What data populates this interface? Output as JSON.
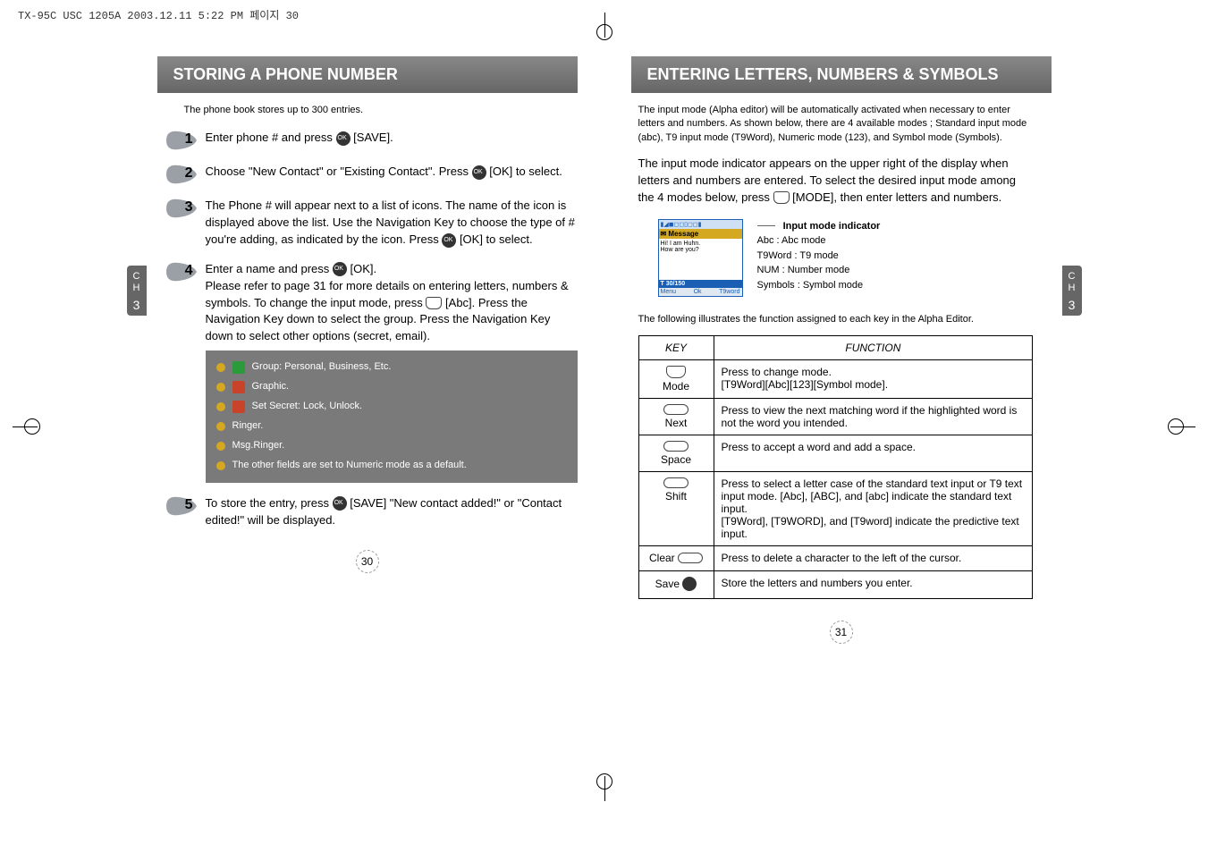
{
  "meta": {
    "header": "TX-95C USC 1205A  2003.12.11 5:22 PM  페이지 30"
  },
  "chapter_tab": {
    "label": "C\nH",
    "num": "3"
  },
  "left": {
    "title": "STORING A PHONE NUMBER",
    "intro": "The phone book stores up to 300 entries.",
    "steps": [
      {
        "n": "1",
        "text_a": "Enter phone # and press ",
        "text_b": " [SAVE]."
      },
      {
        "n": "2",
        "text_a": "Choose \"New Contact\" or \"Existing Contact\". Press ",
        "text_b": " [OK] to select."
      },
      {
        "n": "3",
        "text_a": "The Phone # will appear next to a list of icons. The name of the icon is displayed above the list. Use the Navigation Key to choose the type of # you're adding, as indicated by the icon. Press ",
        "text_b": " [OK] to select."
      },
      {
        "n": "4",
        "text_a": "Enter a name and press ",
        "text_b": " [OK].\nPlease refer to page 31 for more details on entering letters, numbers & symbols. To change the input mode, press ",
        "text_c": " [Abc]. Press the Navigation Key down to select the group. Press the Navigation Key down to select other options (secret, email)."
      },
      {
        "n": "5",
        "text_a": "To store the entry, press ",
        "text_b": " [SAVE] \"New contact added!\" or \"Contact edited!\" will be displayed."
      }
    ],
    "bullets": [
      "Group: Personal, Business, Etc.",
      "Graphic.",
      "Set Secret: Lock, Unlock.",
      "Ringer.",
      "Msg.Ringer.",
      "The other fields are set to Numeric mode as a default."
    ],
    "page_num": "30"
  },
  "right": {
    "title": "ENTERING LETTERS, NUMBERS & SYMBOLS",
    "intro": "The input mode (Alpha editor) will be automatically activated when necessary to enter letters and numbers. As shown below, there are 4 available modes ; Standard input mode (abc), T9 input mode (T9Word), Numeric mode (123), and Symbol mode (Symbols).",
    "intro2_a": "The input mode indicator appears on the upper right of the display when letters and numbers are entered. To select the desired input mode among the 4 modes below, press ",
    "intro2_b": " [MODE], then enter letters and numbers.",
    "phone": {
      "statusbar": "▮◢◼◻◻▯◻◻▮",
      "titlebar": "✉ Message",
      "body_line1": "Hi! I am Huhn.",
      "body_line2": "How are you?",
      "footer": "T 30/150",
      "soft_left": "Menu",
      "soft_mid": "Ok",
      "soft_right": "T9word"
    },
    "indicator": {
      "heading": "Input mode indicator",
      "l1": "Abc : Abc mode",
      "l2": "T9Word : T9 mode",
      "l3": "NUM : Number mode",
      "l4": "Symbols : Symbol mode"
    },
    "table_intro": "The following illustrates the function assigned to each key in the Alpha Editor.",
    "table": {
      "head_key": "KEY",
      "head_func": "FUNCTION",
      "rows": [
        {
          "key": "Mode",
          "func": "Press to change mode.\n[T9Word][Abc][123][Symbol mode]."
        },
        {
          "key": "Next",
          "func": "Press to view the next matching word if the highlighted word is not the word you intended."
        },
        {
          "key": "Space",
          "func": "Press to accept a word and add a space."
        },
        {
          "key": "Shift",
          "func": "Press to select a letter case of the standard text input or T9 text input mode. [Abc], [ABC], and [abc] indicate the standard text input.\n[T9Word], [T9WORD], and [T9word] indicate the predictive text input."
        },
        {
          "key": "Clear",
          "func": "Press to delete a character to the left of the cursor."
        },
        {
          "key": "Save",
          "func": "Store the letters and numbers you enter."
        }
      ]
    },
    "page_num": "31"
  }
}
